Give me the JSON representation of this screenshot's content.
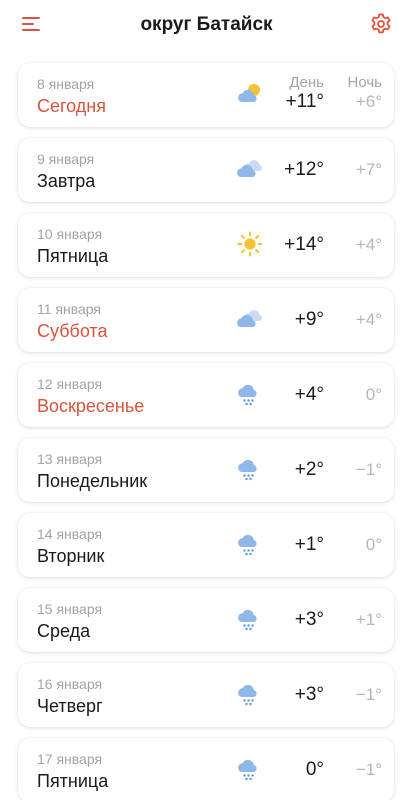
{
  "header": {
    "title": "округ Батайск",
    "menu_icon": "hamburger-menu-icon",
    "settings_icon": "gear-icon",
    "accent_color": "#e0523a"
  },
  "columns": {
    "day": "День",
    "night": "Ночь"
  },
  "days": [
    {
      "date": "8 января",
      "name": "Сегодня",
      "highlight": true,
      "icon": "partly-cloudy-sun-icon",
      "day_temp": "+11°",
      "night_temp": "+6°"
    },
    {
      "date": "9 января",
      "name": "Завтра",
      "highlight": false,
      "icon": "cloudy-icon",
      "day_temp": "+12°",
      "night_temp": "+7°"
    },
    {
      "date": "10 января",
      "name": "Пятница",
      "highlight": false,
      "icon": "sun-icon",
      "day_temp": "+14°",
      "night_temp": "+4°"
    },
    {
      "date": "11 января",
      "name": "Суббота",
      "highlight": true,
      "icon": "cloudy-icon",
      "day_temp": "+9°",
      "night_temp": "+4°"
    },
    {
      "date": "12 января",
      "name": "Воскресенье",
      "highlight": true,
      "icon": "cloud-rain-icon",
      "day_temp": "+4°",
      "night_temp": "0°"
    },
    {
      "date": "13 января",
      "name": "Понедельник",
      "highlight": false,
      "icon": "cloud-rain-icon",
      "day_temp": "+2°",
      "night_temp": "−1°"
    },
    {
      "date": "14 января",
      "name": "Вторник",
      "highlight": false,
      "icon": "cloud-rain-icon",
      "day_temp": "+1°",
      "night_temp": "0°"
    },
    {
      "date": "15 января",
      "name": "Среда",
      "highlight": false,
      "icon": "cloud-rain-icon",
      "day_temp": "+3°",
      "night_temp": "+1°"
    },
    {
      "date": "16 января",
      "name": "Четверг",
      "highlight": false,
      "icon": "cloud-rain-icon",
      "day_temp": "+3°",
      "night_temp": "−1°"
    },
    {
      "date": "17 января",
      "name": "Пятница",
      "highlight": false,
      "icon": "cloud-rain-icon",
      "day_temp": "0°",
      "night_temp": "−1°"
    }
  ]
}
